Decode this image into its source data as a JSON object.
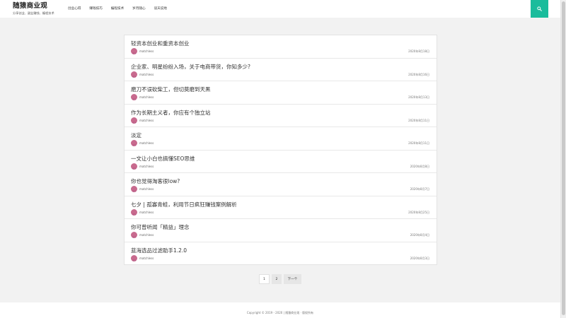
{
  "brand": {
    "title": "随猿商业观",
    "subtitle": "分享创业、副业赚钱、编程技术"
  },
  "nav": [
    {
      "label": "创业心得"
    },
    {
      "label": "赚钱技巧"
    },
    {
      "label": "编程技术"
    },
    {
      "label": "岁月随心"
    },
    {
      "label": "谈天说地"
    }
  ],
  "search": {
    "icon": "search-icon"
  },
  "posts": [
    {
      "title": "轻资本创业和重资本创业",
      "author": "matchless",
      "date": "2020年8月18日"
    },
    {
      "title": "企业家、明星纷纷入场，关于电商带货，你知多少?",
      "author": "matchless",
      "date": "2020年8月16日"
    },
    {
      "title": "磨刀不误砍柴工，但切莫磨到天黑",
      "author": "matchless",
      "date": "2020年8月13日"
    },
    {
      "title": "作为长期主义者，你应有个独立站",
      "author": "matchless",
      "date": "2020年8月11日"
    },
    {
      "title": "淡定",
      "author": "matchless",
      "date": "2020年8月11日"
    },
    {
      "title": "一文让小白也搞懂SEO思维",
      "author": "matchless",
      "date": "2020年8月8日"
    },
    {
      "title": "你也觉得淘客很low?",
      "author": "matchless",
      "date": "2020年8月7日"
    },
    {
      "title": "七夕 | 孤寡青蛙，利用节日疯狂赚钱案例解析",
      "author": "matchless",
      "date": "2020年8月25日"
    },
    {
      "title": "你可曾听闻「精益」理念",
      "author": "matchless",
      "date": "2020年8月4日"
    },
    {
      "title": "蓝海选品过滤助手1.2.0",
      "author": "matchless",
      "date": "2020年8月3日"
    }
  ],
  "pagination": {
    "current": "1",
    "page2": "2",
    "next": "下一个"
  },
  "footer": {
    "text": "Copyright © 2019 - 2020 | 随猿商业观 · 版权所有"
  },
  "colors": {
    "accent": "#1abc9c",
    "avatar": "#c86a8e"
  }
}
